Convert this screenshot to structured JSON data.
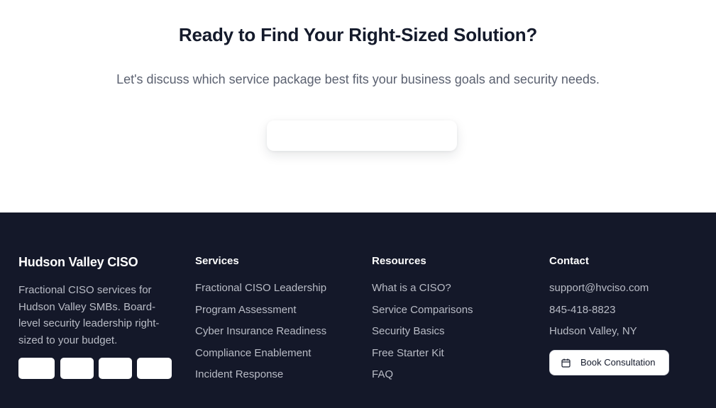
{
  "cta": {
    "title": "Ready to Find Your Right-Sized Solution?",
    "subtitle": "Let's discuss which service package best fits your business goals and security needs."
  },
  "footer": {
    "brand": {
      "title": "Hudson Valley CISO",
      "description": "Fractional CISO services for Hudson Valley SMBs. Board-level security leadership right-sized to your budget."
    },
    "services": {
      "title": "Services",
      "items": [
        "Fractional CISO Leadership",
        "Program Assessment",
        "Cyber Insurance Readiness",
        "Compliance Enablement",
        "Incident Response"
      ]
    },
    "resources": {
      "title": "Resources",
      "items": [
        "What is a CISO?",
        "Service Comparisons",
        "Security Basics",
        "Free Starter Kit",
        "FAQ"
      ]
    },
    "contact": {
      "title": "Contact",
      "items": [
        "support@hvciso.com",
        "845-418-8823",
        "Hudson Valley, NY"
      ],
      "button_label": "Book Consultation",
      "button_icon": "calendar-icon"
    },
    "colors": {
      "background": "#141829",
      "text_muted": "#b9bcc6",
      "heading": "#ffffff"
    }
  }
}
